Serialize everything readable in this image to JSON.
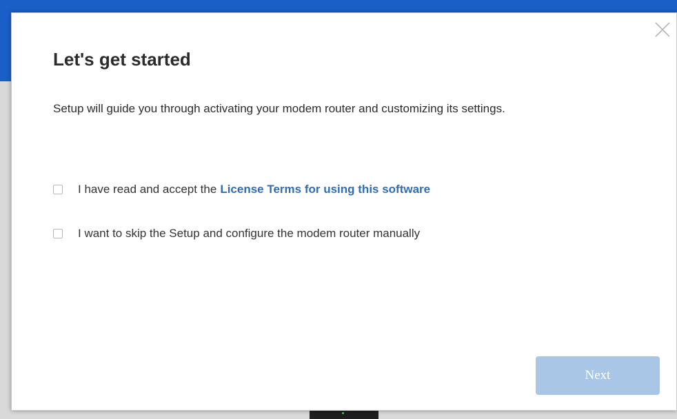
{
  "dialog": {
    "title": "Let's get started",
    "description": "Setup will guide you through activating your modem router and customizing its settings.",
    "options": [
      {
        "text": "I have read and accept the",
        "link_text": "License Terms for using this software",
        "checked": false
      },
      {
        "text": "I want to skip the Setup and configure the modem router manually",
        "checked": false
      }
    ],
    "next_label": "Next",
    "next_enabled": false,
    "close_icon": "close-icon"
  },
  "colors": {
    "header_band": "#1a5fc7",
    "link": "#2f6db5",
    "next_button_disabled": "#a9c6e6"
  }
}
